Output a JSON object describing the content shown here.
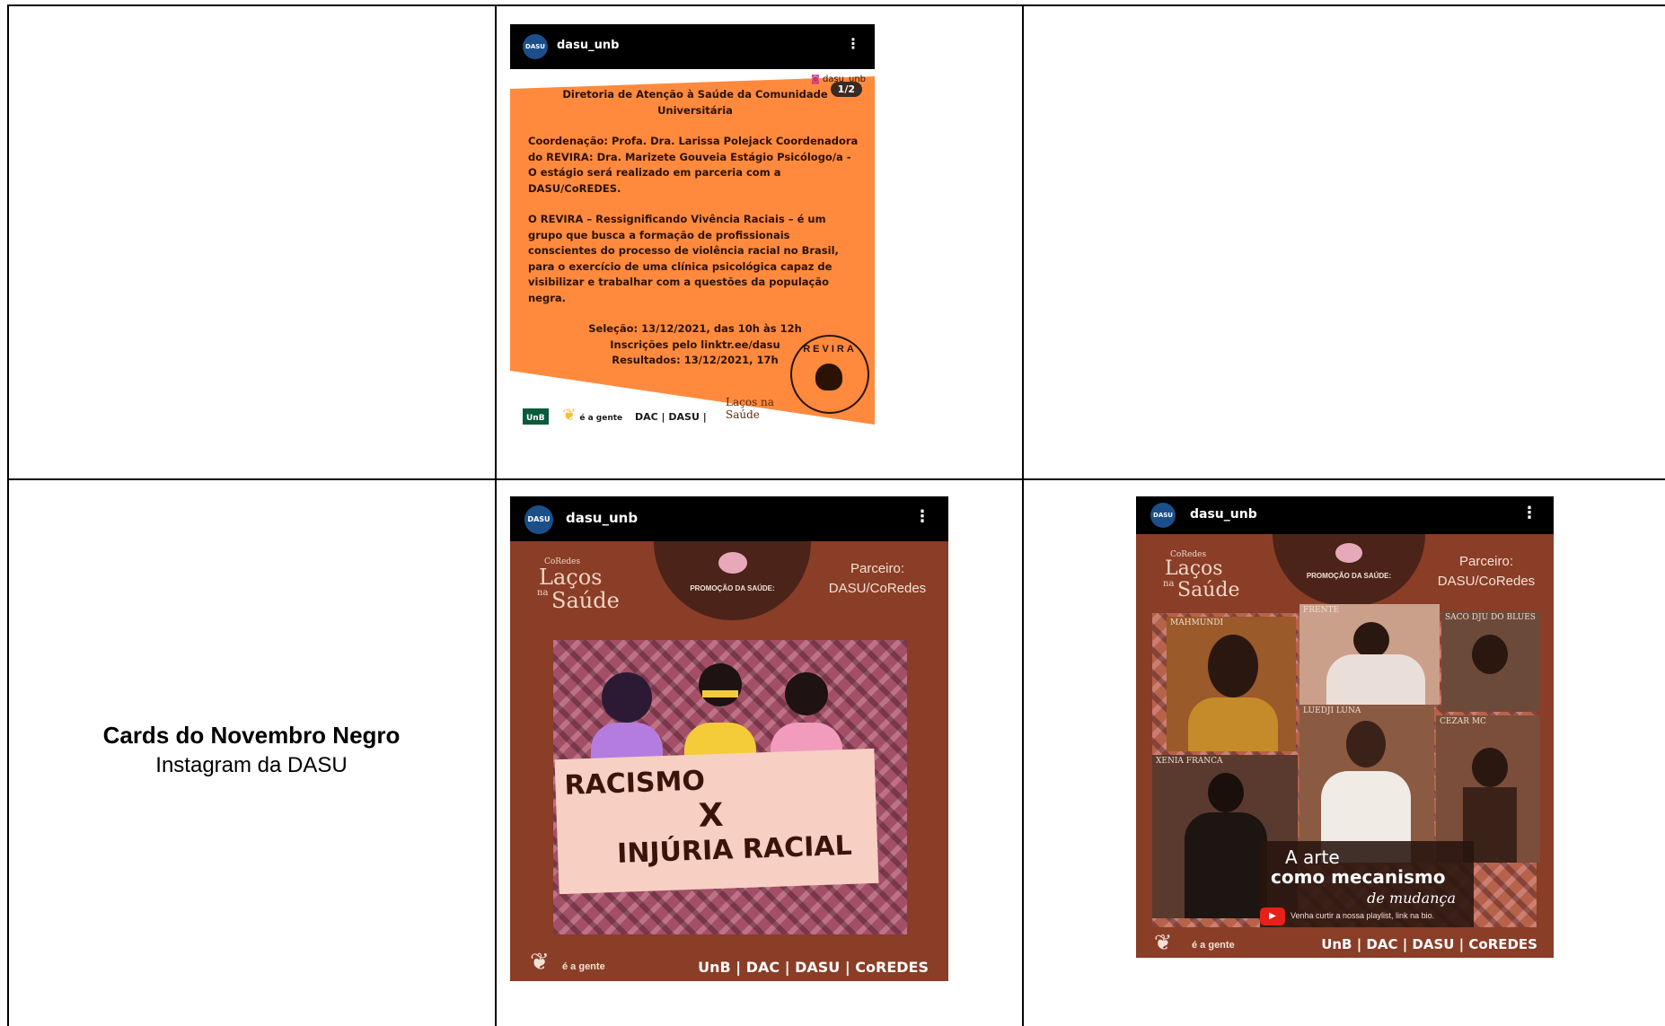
{
  "table": {
    "row2_title": "Cards do Novembro Negro",
    "row2_subtitle": "Instagram da DASU"
  },
  "post1": {
    "username": "dasu_unb",
    "avatar_text": "DASU",
    "handle": "dasu_unb",
    "slide_counter": "1/2",
    "title": "Diretoria de Atenção à Saúde da Comunidade Universitária",
    "para1": "Coordenação: Profa. Dra. Larissa Polejack Coordenadora do REVIRA: Dra. Marizete Gouveia Estágio Psicólogo/a - O estágio será realizado em parceria com a DASU/CoREDES.",
    "para2": "O REVIRA – Ressignificando Vivência Raciais – é um grupo que busca a formação de profissionais conscientes do processo de violência racial no Brasil, para o exercício de uma clínica psicológica capaz de visibilizar e trabalhar com a questões da população negra.",
    "selecao": "Seleção: 13/12/2021, das 10h às 12h",
    "inscricoes": "Inscrições pelo linktr.ee/dasu",
    "resultados": "Resultados: 13/12/2021, 17h",
    "footer": "DAC | DASU |",
    "unb_logo": "UnB",
    "agente": "é a gente",
    "revira": "REVIRA",
    "lacos": "Laços na Saúde"
  },
  "post2": {
    "username": "dasu_unb",
    "avatar_text": "DASU",
    "lacos_small": "CoRedes",
    "lacos": "Laços",
    "na": "na",
    "saude": "Saúde",
    "promo": "PROMOÇÃO DA SAÚDE:",
    "parceiro_label": "Parceiro:",
    "parceiro_value": "DASU/CoRedes",
    "banner_line1": "RACISMO",
    "banner_line2": "X",
    "banner_line3": "INJÚRIA RACIAL",
    "agente": "é a gente",
    "footer": "UnB | DAC | DASU | CoREDES"
  },
  "post3": {
    "username": "dasu_unb",
    "avatar_text": "DASU",
    "lacos_small": "CoRedes",
    "lacos": "Laços",
    "na": "na",
    "saude": "Saúde",
    "promo": "PROMOÇÃO DA SAÚDE:",
    "parceiro_label": "Parceiro:",
    "parceiro_value": "DASU/CoRedes",
    "photo_labels": [
      "MAHMUNDI",
      "FRENTE",
      "SACO DJU DO BLUES",
      "LUEDJI LUNA",
      "CEZAR MC",
      "XENIA FRANCA"
    ],
    "arte_line1": "A arte",
    "arte_line2": "como mecanismo",
    "arte_line3": "de mudança",
    "playlist": "Venha curtir a nossa playlist, link na bio.",
    "agente": "é a gente",
    "footer": "UnB | DAC | DASU | CoREDES"
  }
}
